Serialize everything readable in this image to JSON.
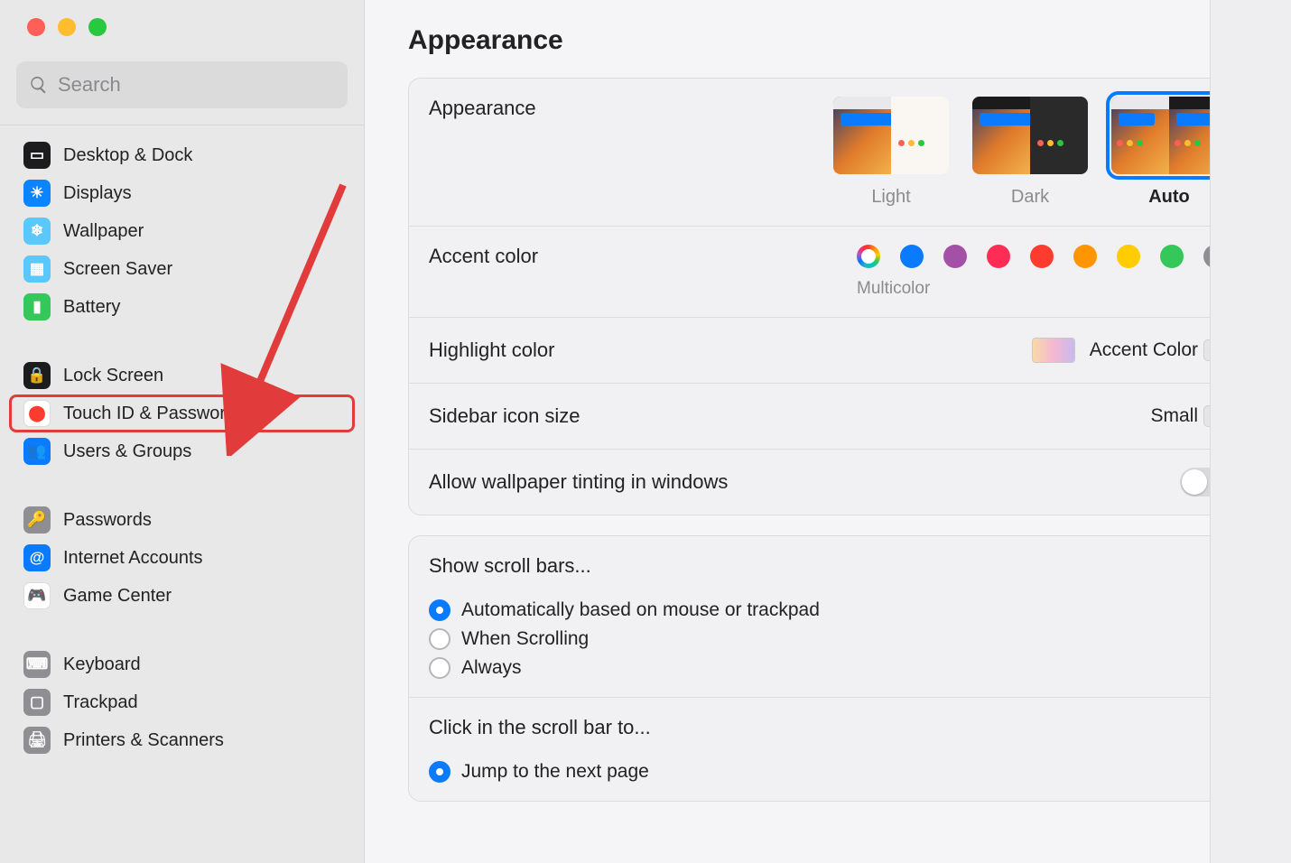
{
  "search": {
    "placeholder": "Search"
  },
  "sidebar": {
    "groups": [
      [
        {
          "label": "Desktop & Dock",
          "icon_bg": "#1c1c1e",
          "glyph": "▭"
        },
        {
          "label": "Displays",
          "icon_bg": "#0a84ff",
          "glyph": "☀"
        },
        {
          "label": "Wallpaper",
          "icon_bg": "#5ac8fa",
          "glyph": "❄"
        },
        {
          "label": "Screen Saver",
          "icon_bg": "#5ac8fa",
          "glyph": "▦"
        },
        {
          "label": "Battery",
          "icon_bg": "#34c759",
          "glyph": "▮"
        }
      ],
      [
        {
          "label": "Lock Screen",
          "icon_bg": "#1c1c1e",
          "glyph": "🔒"
        },
        {
          "label": "Touch ID & Password",
          "icon_bg": "#ffffff",
          "glyph": "⬤",
          "glyph_color": "#ff3b30",
          "highlighted": true
        },
        {
          "label": "Users & Groups",
          "icon_bg": "#0a7aff",
          "glyph": "👥"
        }
      ],
      [
        {
          "label": "Passwords",
          "icon_bg": "#8e8e93",
          "glyph": "🔑"
        },
        {
          "label": "Internet Accounts",
          "icon_bg": "#0a7aff",
          "glyph": "@"
        },
        {
          "label": "Game Center",
          "icon_bg": "#ffffff",
          "glyph": "🎮",
          "glyph_color": "#ff6482"
        }
      ],
      [
        {
          "label": "Keyboard",
          "icon_bg": "#8e8e93",
          "glyph": "⌨"
        },
        {
          "label": "Trackpad",
          "icon_bg": "#8e8e93",
          "glyph": "▢"
        },
        {
          "label": "Printers & Scanners",
          "icon_bg": "#8e8e93",
          "glyph": "🖨"
        }
      ]
    ]
  },
  "page": {
    "title": "Appearance"
  },
  "appearance": {
    "row_label": "Appearance",
    "tiles": [
      {
        "label": "Light",
        "selected": false
      },
      {
        "label": "Dark",
        "selected": false
      },
      {
        "label": "Auto",
        "selected": true
      }
    ]
  },
  "accent": {
    "row_label": "Accent color",
    "colors": [
      "multicolor",
      "#0a7aff",
      "#a550a7",
      "#ff2d55",
      "#ff3b30",
      "#ff9500",
      "#ffcc00",
      "#34c759",
      "#8e8e93"
    ],
    "selected_label": "Multicolor"
  },
  "highlight": {
    "row_label": "Highlight color",
    "value": "Accent Color"
  },
  "sidebar_size": {
    "row_label": "Sidebar icon size",
    "value": "Small"
  },
  "tinting": {
    "row_label": "Allow wallpaper tinting in windows",
    "on": false
  },
  "scrollbars": {
    "title": "Show scroll bars...",
    "options": [
      "Automatically based on mouse or trackpad",
      "When Scrolling",
      "Always"
    ],
    "selected_index": 0
  },
  "clickbar": {
    "title": "Click in the scroll bar to...",
    "options": [
      "Jump to the next page"
    ],
    "selected_index": 0
  }
}
